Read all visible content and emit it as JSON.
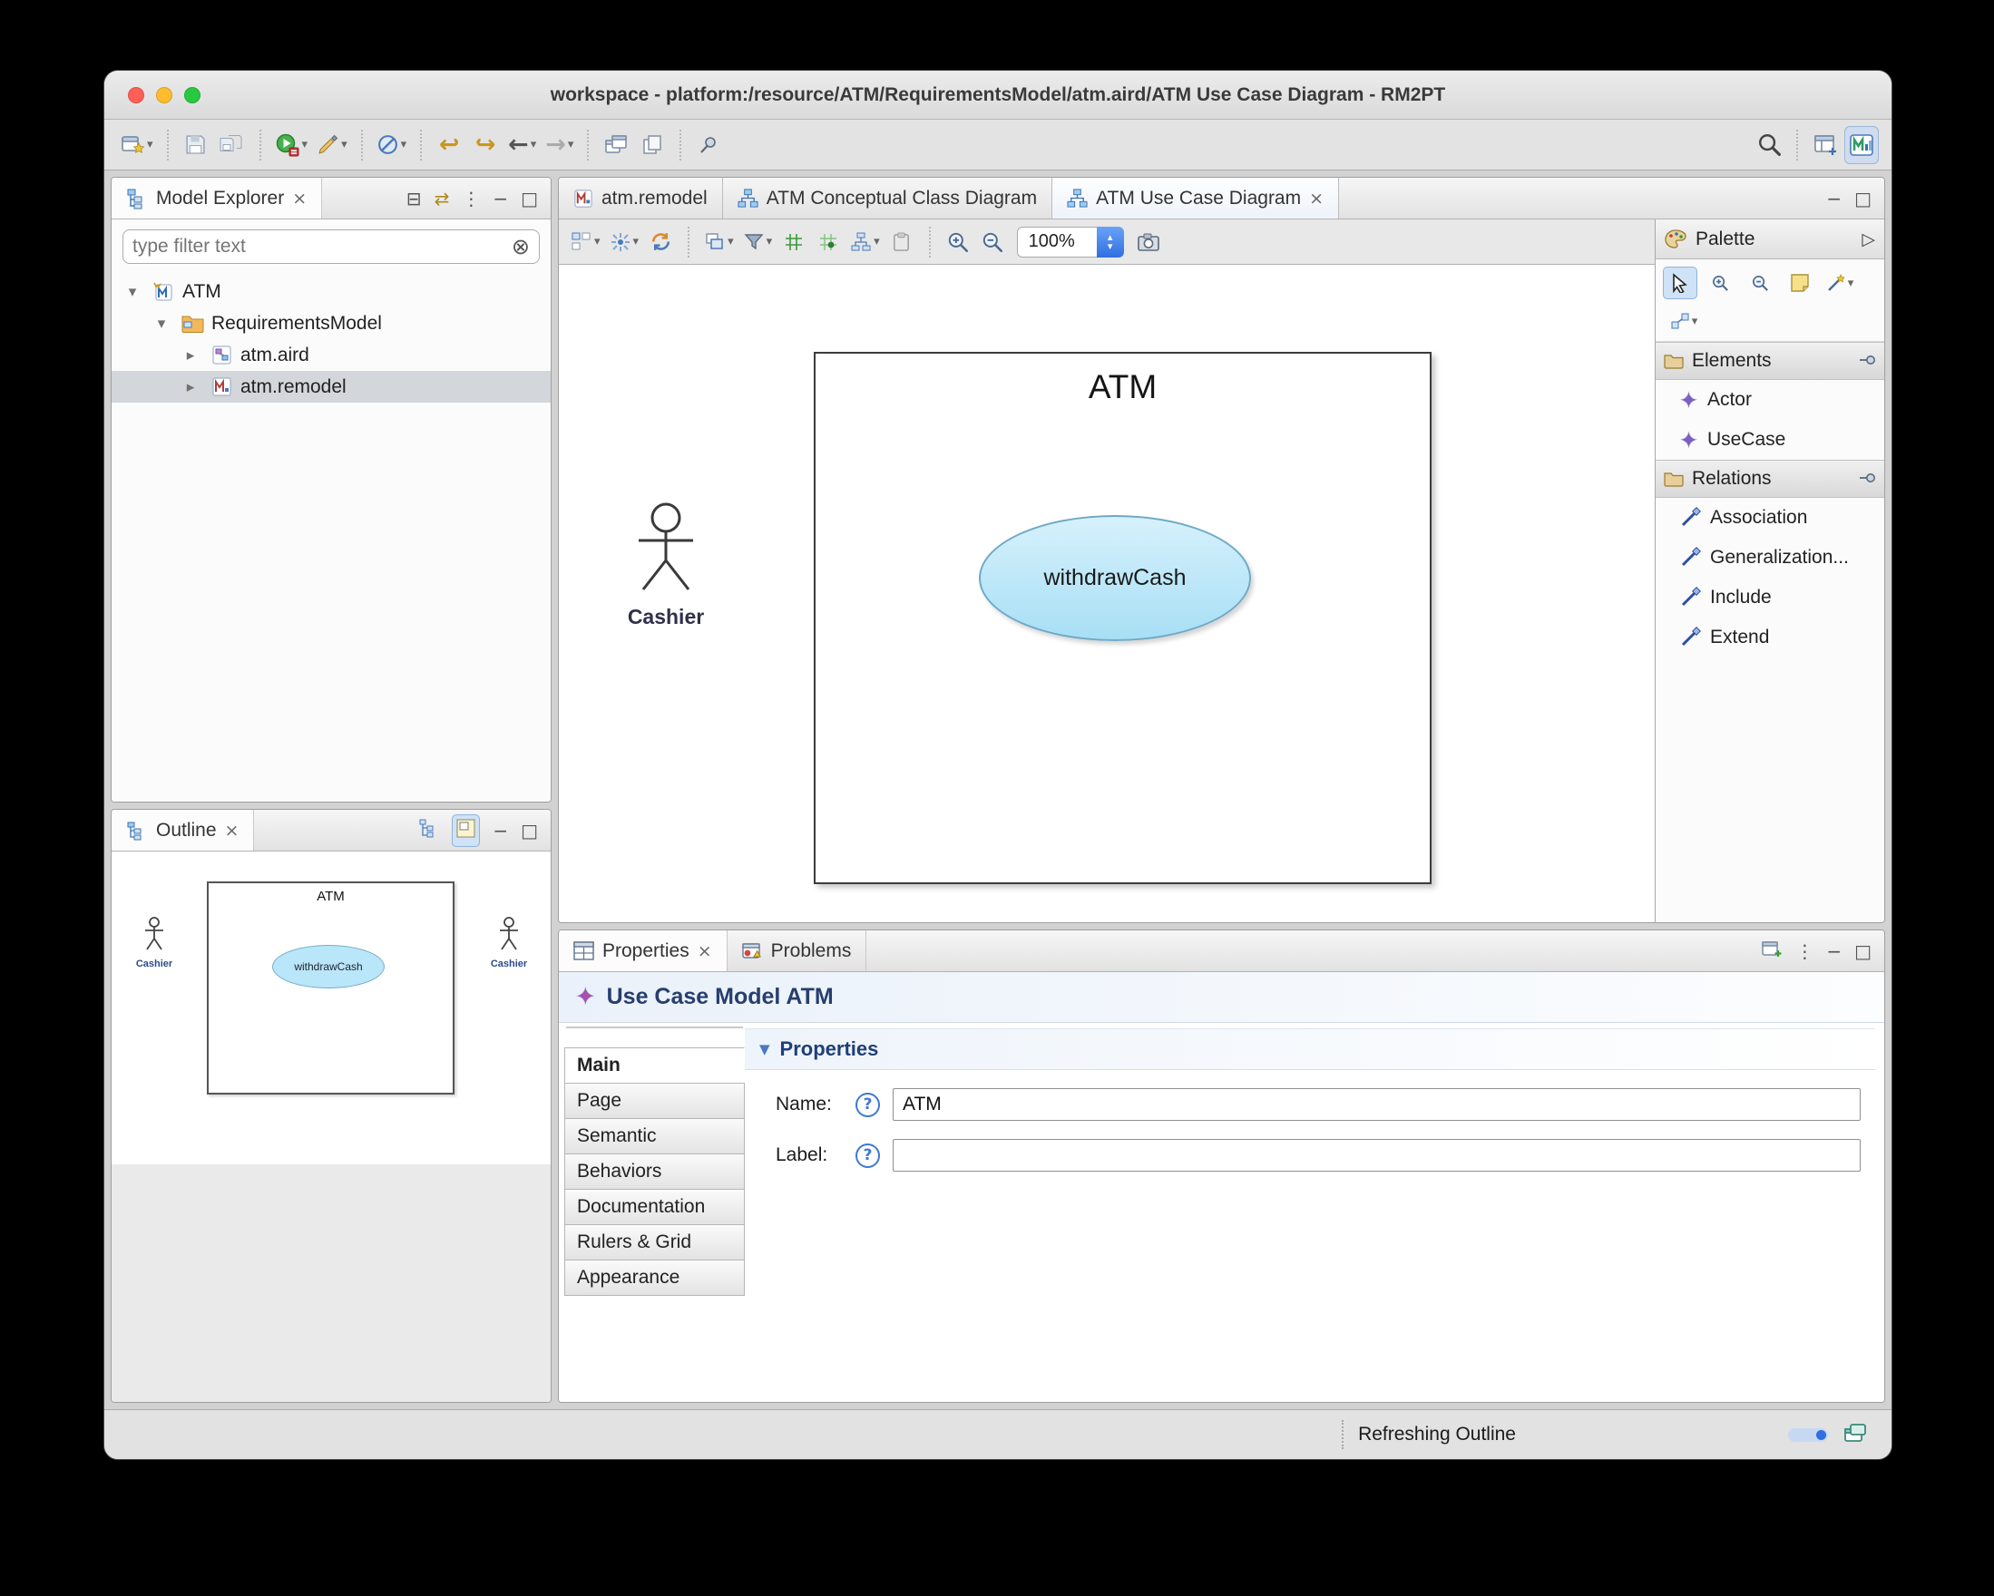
{
  "window": {
    "title": "workspace - platform:/resource/ATM/RequirementsModel/atm.aird/ATM Use Case Diagram - RM2PT"
  },
  "icons": {
    "dropdown": "▾",
    "close": "×",
    "tree_expanded": "▾",
    "tree_collapsed": "▸",
    "minimize": "−",
    "maximize": "□",
    "menu": "⋮",
    "collapse_all": "⊟",
    "link_editor": "⇄",
    "clear": "⊗",
    "palette_arrow": "▷",
    "star": "✦",
    "help": "?",
    "section_toggle": "▼",
    "back": "←",
    "forward": "→",
    "prev_edit": "↩",
    "next_edit": "↪",
    "stepper_up": "▴",
    "stepper_down": "▾"
  },
  "model_explorer": {
    "title": "Model Explorer",
    "filter_placeholder": "type filter text",
    "tree": [
      {
        "label": "ATM"
      },
      {
        "label": "RequirementsModel"
      },
      {
        "label": "atm.aird"
      },
      {
        "label": "atm.remodel"
      }
    ]
  },
  "outline": {
    "title": "Outline",
    "thumb": {
      "system": "ATM",
      "usecase": "withdrawCash",
      "actor_left": "Cashier",
      "actor_right": "Cashier"
    }
  },
  "editor": {
    "tabs": [
      {
        "label": "atm.remodel"
      },
      {
        "label": "ATM Conceptual Class Diagram"
      },
      {
        "label": "ATM Use Case Diagram"
      }
    ],
    "zoom": "100%",
    "diagram": {
      "system": "ATM",
      "usecase": "withdrawCash",
      "actor": "Cashier"
    }
  },
  "palette": {
    "title": "Palette",
    "elements_header": "Elements",
    "relations_header": "Relations",
    "elements": [
      {
        "label": "Actor"
      },
      {
        "label": "UseCase"
      }
    ],
    "relations": [
      {
        "label": "Association"
      },
      {
        "label": "Generalization..."
      },
      {
        "label": "Include"
      },
      {
        "label": "Extend"
      }
    ]
  },
  "properties": {
    "tab_properties": "Properties",
    "tab_problems": "Problems",
    "header": "Use Case Model ATM",
    "side_tabs": [
      {
        "label": "Main"
      },
      {
        "label": "Page"
      },
      {
        "label": "Semantic"
      },
      {
        "label": "Behaviors"
      },
      {
        "label": "Documentation"
      },
      {
        "label": "Rulers & Grid"
      },
      {
        "label": "Appearance"
      }
    ],
    "section": "Properties",
    "name_label": "Name:",
    "name_value": "ATM",
    "label_label": "Label:",
    "label_value": ""
  },
  "status": {
    "text": "Refreshing Outline"
  },
  "colors": {
    "usecase_fill": "#a8dff5",
    "selection": "#d3d6da",
    "accent_blue": "#2f6fe0"
  }
}
